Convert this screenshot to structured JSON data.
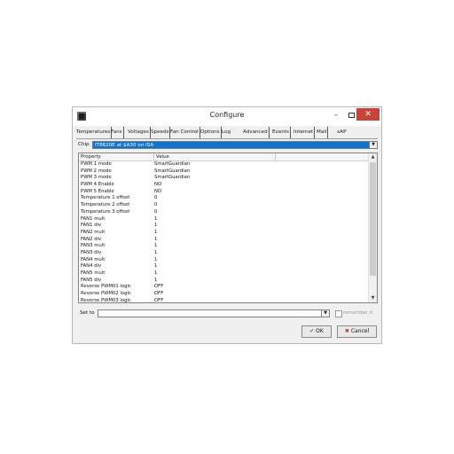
{
  "window": {
    "title": "Configure"
  },
  "tabs": [
    "Temperatures",
    "Fans",
    "Voltages",
    "Speeds",
    "Fan Control",
    "Options",
    "Log",
    "Advanced",
    "Events",
    "Internet",
    "Mail",
    "xAP"
  ],
  "active_tab": "Advanced",
  "chip": {
    "label": "Chip",
    "value": "IT8620E at $A30 on ISA"
  },
  "grid": {
    "columns": [
      "Property",
      "Value"
    ],
    "rows": [
      [
        "PWM 1 mode",
        "SmartGuardian"
      ],
      [
        "PWM 2 mode",
        "SmartGuardian"
      ],
      [
        "PWM 3 mode",
        "SmartGuardian"
      ],
      [
        "PWM 4 Enable",
        "NO"
      ],
      [
        "PWM 5 Enable",
        "NO"
      ],
      [
        "Temperature 1 offset",
        "0"
      ],
      [
        "Temperature 2 offset",
        "0"
      ],
      [
        "Temperature 3 offset",
        "0"
      ],
      [
        "FAN1 mult",
        "1"
      ],
      [
        "FAN1 div",
        "1"
      ],
      [
        "FAN2 mult",
        "1"
      ],
      [
        "FAN2 div",
        "1"
      ],
      [
        "FAN3 mult",
        "1"
      ],
      [
        "FAN3 div",
        "1"
      ],
      [
        "FAN4 mult",
        "1"
      ],
      [
        "FAN4 div",
        "1"
      ],
      [
        "FAN5 mult",
        "1"
      ],
      [
        "FAN5 div",
        "1"
      ],
      [
        "Reverse PWM01 logic",
        "OFF"
      ],
      [
        "Reverse PWM02 logic",
        "OFF"
      ],
      [
        "Reverse PWM03 logic",
        "OFF"
      ]
    ]
  },
  "set_to": {
    "label": "Set to",
    "value": "",
    "remember_label": "remember it"
  },
  "buttons": {
    "ok": "OK",
    "cancel": "Cancel"
  }
}
